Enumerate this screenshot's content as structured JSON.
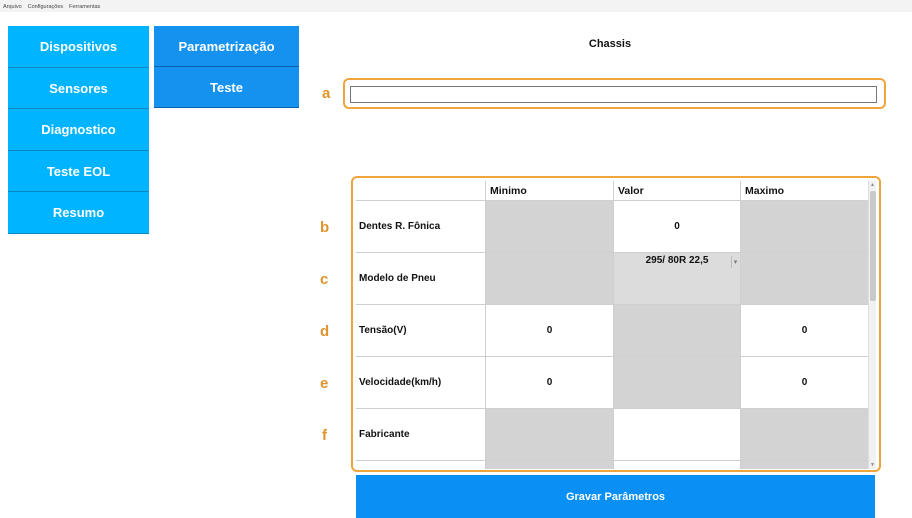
{
  "menu": [
    "Arquivo",
    "Configurações",
    "Ferramentas"
  ],
  "nav_primary": [
    "Dispositivos",
    "Sensores",
    "Diagnostico",
    "Teste EOL",
    "Resumo"
  ],
  "nav_secondary": [
    "Parametrização",
    "Teste"
  ],
  "chassis": {
    "title": "Chassis",
    "value": ""
  },
  "annotations": [
    "a",
    "b",
    "c",
    "d",
    "e",
    "f"
  ],
  "table": {
    "headers": [
      "",
      "Minimo",
      "Valor",
      "Maximo"
    ],
    "rows": [
      {
        "label": "Dentes R. Fônica",
        "min": "",
        "value": "0",
        "max": ""
      },
      {
        "label": "Modelo de Pneu",
        "min": "",
        "value": "295/ 80R 22,5",
        "max": ""
      },
      {
        "label": "Tensão(V)",
        "min": "0",
        "value": "",
        "max": "0"
      },
      {
        "label": "Velocidade(km/h)",
        "min": "0",
        "value": "",
        "max": "0"
      },
      {
        "label": "Fabricante",
        "min": "",
        "value": "",
        "max": ""
      }
    ]
  },
  "save_button": "Gravar Parâmetros",
  "colors": {
    "nav": "#00b4ff",
    "nav_dark": "#1592f0",
    "accent": "#f0a43c",
    "save": "#0a8ff5",
    "disabled_cell": "#d3d3d3"
  }
}
